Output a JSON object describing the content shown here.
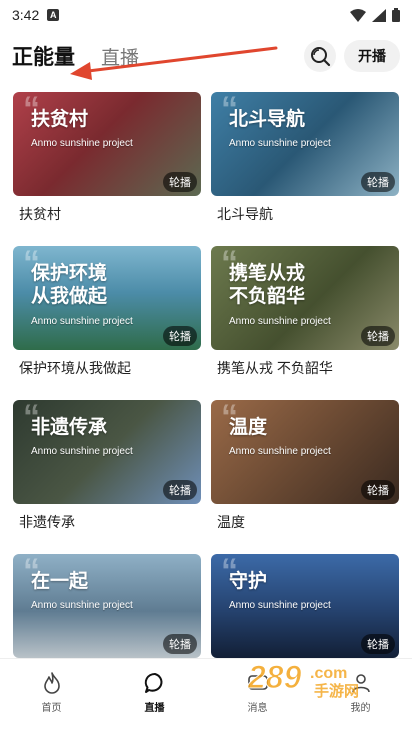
{
  "status_bar": {
    "time": "3:42",
    "notification": "A"
  },
  "header": {
    "tabs": [
      {
        "label": "正能量",
        "active": true
      },
      {
        "label": "直播",
        "active": false
      }
    ],
    "search_icon": "search-icon",
    "live_button": "开播"
  },
  "cards": [
    {
      "overlay": "扶贫村",
      "subtitle": "Anmo sunshine project",
      "badge": "轮播",
      "label": "扶贫村",
      "bg": "#8a3036"
    },
    {
      "overlay": "北斗导航",
      "subtitle": "Anmo sunshine project",
      "badge": "轮播",
      "label": "北斗导航",
      "bg": "#2d6a8f"
    },
    {
      "overlay": "保护环境\n从我做起",
      "subtitle": "Anmo sunshine project",
      "badge": "轮播",
      "label": "保护环境从我做起",
      "bg": "#4c8ca8"
    },
    {
      "overlay": "携笔从戎\n不负韶华",
      "subtitle": "Anmo sunshine project",
      "badge": "轮播",
      "label": "携笔从戎 不负韶华",
      "bg": "#55623d"
    },
    {
      "overlay": "非遗传承",
      "subtitle": "Anmo sunshine project",
      "badge": "轮播",
      "label": "非遗传承",
      "bg": "#3a4236"
    },
    {
      "overlay": "温度",
      "subtitle": "Anmo sunshine project",
      "badge": "轮播",
      "label": "温度",
      "bg": "#6b4a33"
    },
    {
      "overlay": "在一起",
      "subtitle": "Anmo sunshine project",
      "badge": "轮播",
      "label": "",
      "bg": "#5f7c92"
    },
    {
      "overlay": "守护",
      "subtitle": "Anmo sunshine project",
      "badge": "轮播",
      "label": "",
      "bg": "#25426e"
    }
  ],
  "bottom_nav": [
    {
      "label": "首页",
      "icon": "flame-icon",
      "active": false
    },
    {
      "label": "直播",
      "icon": "chat-bubble-icon",
      "active": true
    },
    {
      "label": "消息",
      "icon": "message-icon",
      "active": false
    },
    {
      "label": "我的",
      "icon": "profile-icon",
      "active": false
    }
  ],
  "colors": {
    "arrow": "#e0462e",
    "watermark": "#f2a21b"
  }
}
